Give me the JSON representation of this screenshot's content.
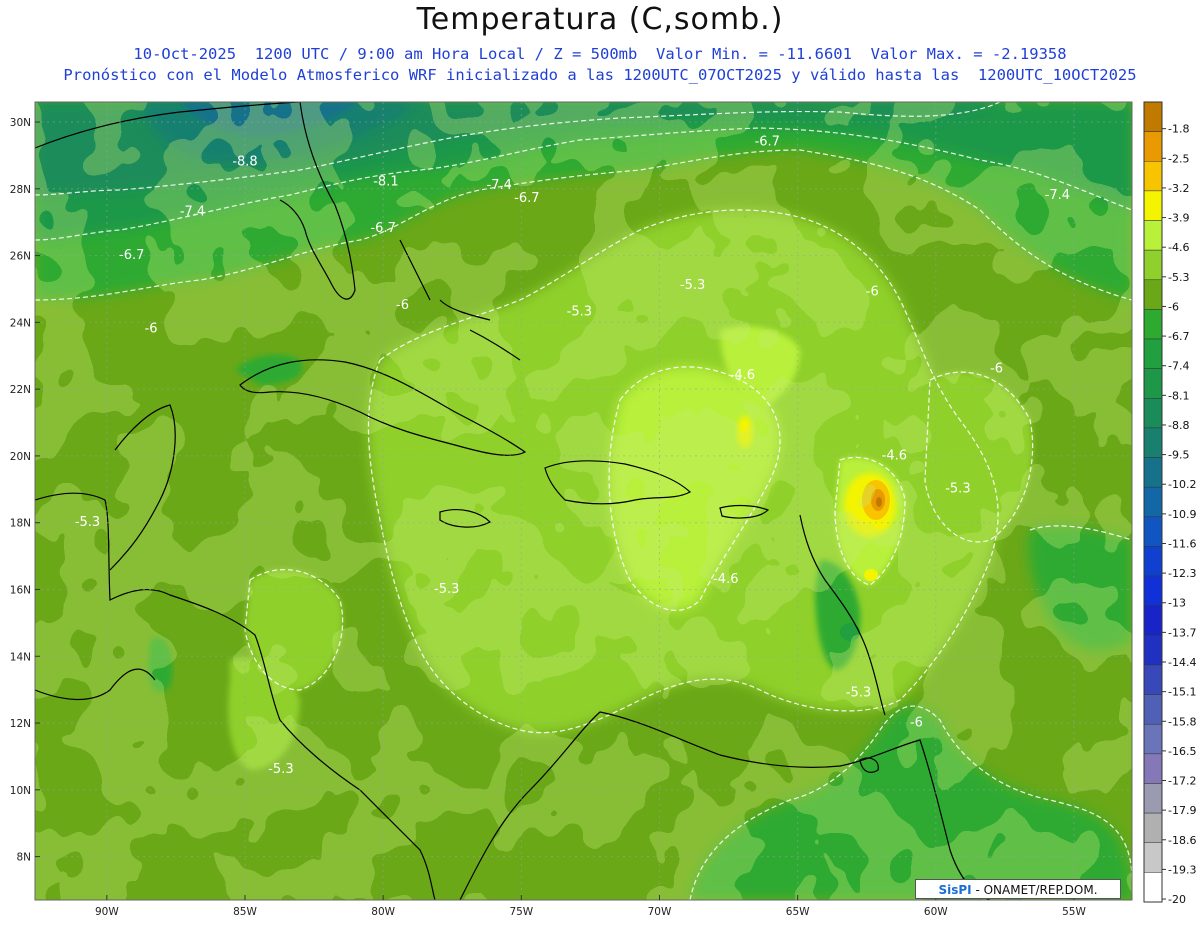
{
  "header": {
    "title": "Temperatura (C,somb.)",
    "subtitle1": "10-Oct-2025  1200 UTC / 9:00 am Hora Local / Z = 500mb  Valor Min. = -11.6601  Valor Max. = -2.19358",
    "subtitle2": "Pronóstico con el Modelo Atmosferico WRF inicializado a las 1200UTC_07OCT2025 y válido hasta las  1200UTC_10OCT2025"
  },
  "axes": {
    "lon_labels": [
      "90W",
      "85W",
      "80W",
      "75W",
      "70W",
      "65W",
      "60W",
      "55W"
    ],
    "lat_labels": [
      "30N",
      "28N",
      "26N",
      "24N",
      "22N",
      "20N",
      "18N",
      "16N",
      "14N",
      "12N",
      "10N",
      "8N"
    ]
  },
  "colorbar": {
    "labels": [
      "-1.8",
      "-2.5",
      "-3.2",
      "-3.9",
      "-4.6",
      "-5.3",
      "-6",
      "-6.7",
      "-7.4",
      "-8.1",
      "-8.8",
      "-9.5",
      "-10.2",
      "-10.9",
      "-11.6",
      "-12.3",
      "-13",
      "-13.7",
      "-14.4",
      "-15.1",
      "-15.8",
      "-16.5",
      "-17.2",
      "-17.9",
      "-18.6",
      "-19.3",
      "-20"
    ],
    "colors": [
      "#c07a00",
      "#e89a00",
      "#f8c400",
      "#f4f400",
      "#b8f03a",
      "#8fd02c",
      "#6aa818",
      "#2eaa30",
      "#22a040",
      "#1c9848",
      "#1a8c5a",
      "#198070",
      "#16728a",
      "#1268a6",
      "#1055c2",
      "#1040d0",
      "#1030d8",
      "#1824c8",
      "#2030c0",
      "#3848b8",
      "#5060b4",
      "#6a74b8",
      "#8478b8",
      "#9a9ab0",
      "#b0b0b0",
      "#c8c8c8",
      "#ffffff"
    ]
  },
  "contour_labels": [
    {
      "text": "-8.8",
      "lon": -85.0,
      "lat": 28.7
    },
    {
      "text": "-8.1",
      "lon": -79.9,
      "lat": 28.1
    },
    {
      "text": "-7.4",
      "lon": -75.8,
      "lat": 28.0
    },
    {
      "text": "-6.7",
      "lon": -74.8,
      "lat": 27.6
    },
    {
      "text": "-6.7",
      "lon": -66.1,
      "lat": 29.3
    },
    {
      "text": "-7.4",
      "lon": -86.9,
      "lat": 27.2
    },
    {
      "text": "-6.7",
      "lon": -80.0,
      "lat": 26.7
    },
    {
      "text": "-7.4",
      "lon": -55.6,
      "lat": 27.7
    },
    {
      "text": "-6.7",
      "lon": -89.1,
      "lat": 25.9
    },
    {
      "text": "-5.3",
      "lon": -68.8,
      "lat": 25.0
    },
    {
      "text": "-6",
      "lon": -62.3,
      "lat": 24.8
    },
    {
      "text": "-6",
      "lon": -79.3,
      "lat": 24.4
    },
    {
      "text": "-5.3",
      "lon": -72.9,
      "lat": 24.2
    },
    {
      "text": "-6",
      "lon": -88.4,
      "lat": 23.7
    },
    {
      "text": "-6",
      "lon": -57.8,
      "lat": 22.5
    },
    {
      "text": "-4.6",
      "lon": -67.0,
      "lat": 22.3
    },
    {
      "text": "-4.6",
      "lon": -61.5,
      "lat": 19.9
    },
    {
      "text": "-5.3",
      "lon": -59.2,
      "lat": 18.9
    },
    {
      "text": "-5.3",
      "lon": -90.7,
      "lat": 17.9
    },
    {
      "text": "-5.3",
      "lon": -77.7,
      "lat": 15.9
    },
    {
      "text": "-4.6",
      "lon": -67.6,
      "lat": 16.2
    },
    {
      "text": "-5.3",
      "lon": -62.8,
      "lat": 12.8
    },
    {
      "text": "-6",
      "lon": -60.7,
      "lat": 11.9
    },
    {
      "text": "-5.3",
      "lon": -83.7,
      "lat": 10.5
    }
  ],
  "credit": {
    "logo": "SisPI",
    "text": "- ONAMET/REP.DOM."
  }
}
